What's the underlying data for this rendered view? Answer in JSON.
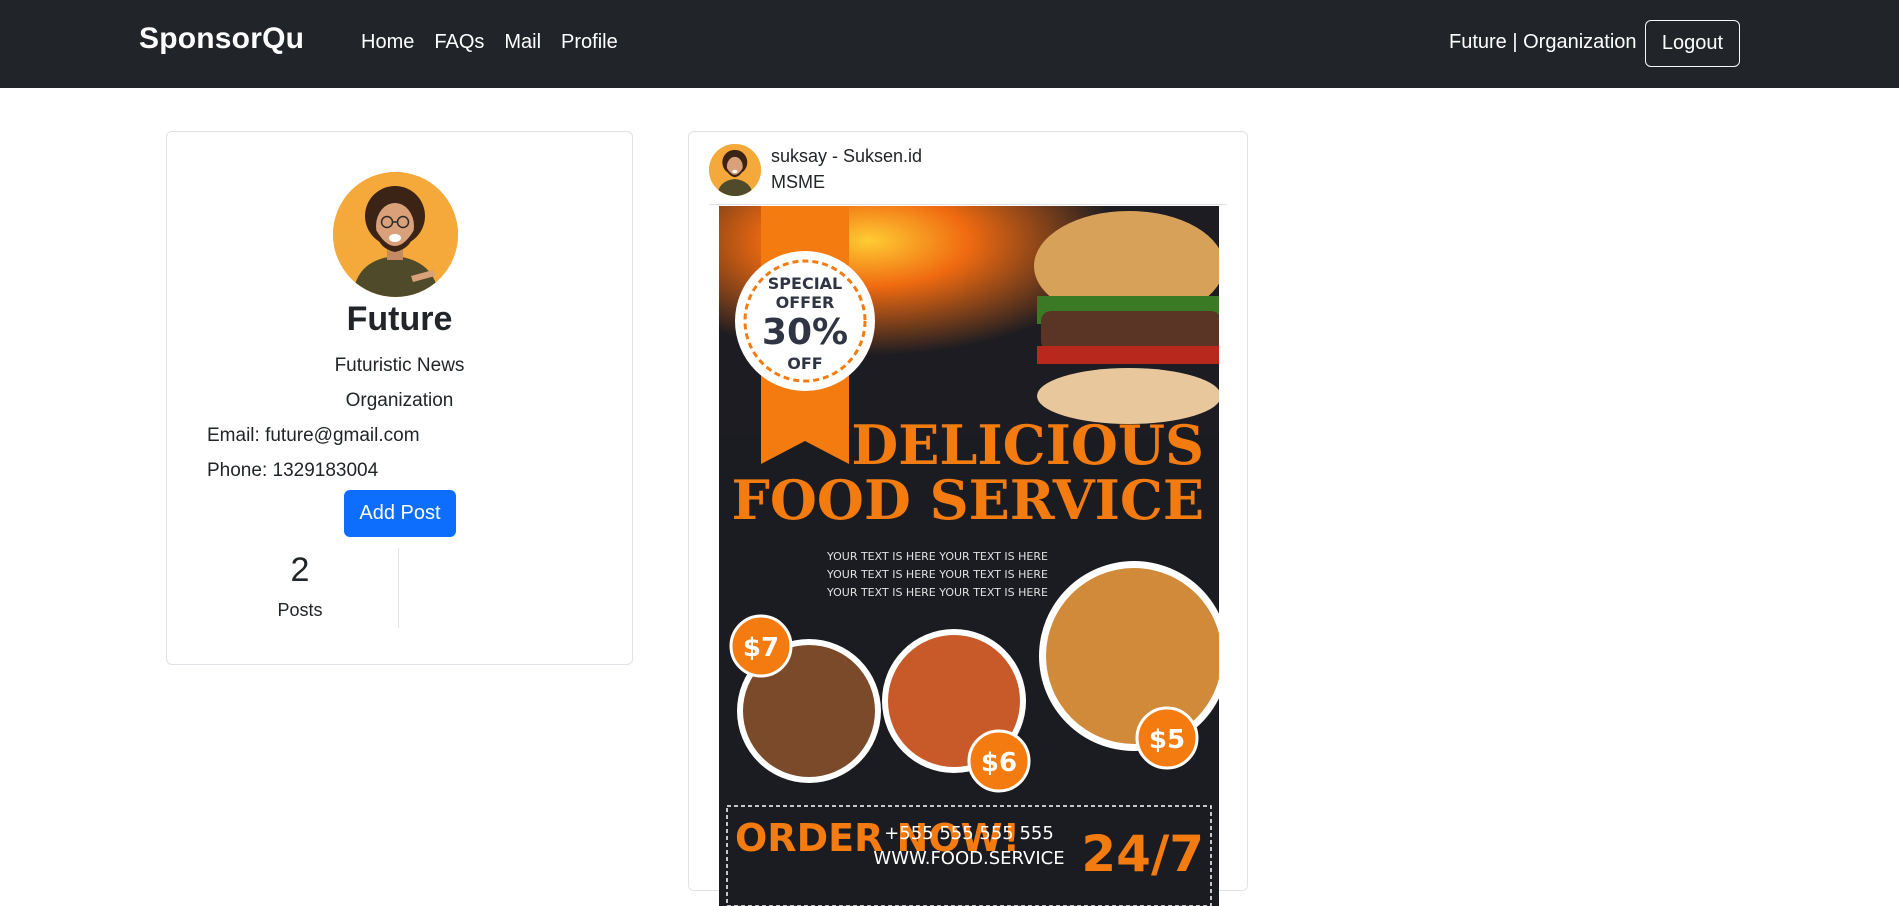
{
  "navbar": {
    "brand": "SponsorQu",
    "links": [
      "Home",
      "FAQs",
      "Mail",
      "Profile"
    ],
    "user": "Future | Organization",
    "logout": "Logout"
  },
  "profile": {
    "name": "Future",
    "desc_line1": "Futuristic News",
    "desc_line2": "Organization",
    "email": "Email: future@gmail.com",
    "phone": "Phone: 1329183004",
    "add_post": "Add Post",
    "posts_count": "2",
    "posts_label": "Posts"
  },
  "post": {
    "author": "suksay - Suksen.id",
    "category": "MSME",
    "flyer": {
      "badge": [
        "SPECIAL",
        "OFFER",
        "30%",
        "OFF"
      ],
      "headline1": "DELICIOUS",
      "headline2": "FOOD SERVICE",
      "placeholder_lines": [
        "YOUR TEXT IS HERE YOUR TEXT IS HERE",
        "YOUR TEXT IS HERE YOUR TEXT IS HERE",
        "YOUR TEXT IS HERE YOUR TEXT IS HERE"
      ],
      "prices": [
        "$7",
        "$6",
        "$5"
      ],
      "order_now": "ORDER NOW!",
      "phone": "+555 555 555 555",
      "website": "WWW.FOOD.SERVICE",
      "hours": "24/7"
    }
  },
  "colors": {
    "navbar_bg": "#212529",
    "primary": "#0d6efd",
    "flyer_orange": "#f47b10",
    "avatar_bg": "#f6a93b"
  }
}
